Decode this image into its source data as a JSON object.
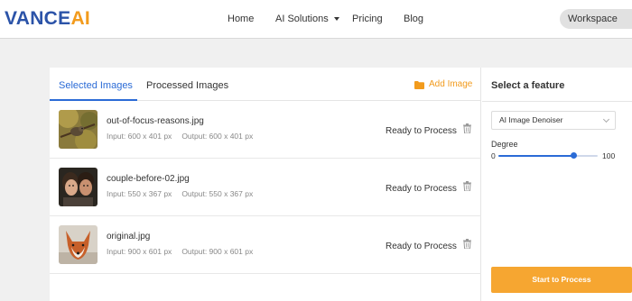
{
  "brand": {
    "part1": "VANCE",
    "part2": "AI"
  },
  "nav": {
    "home": "Home",
    "ai_solutions": "AI Solutions",
    "pricing": "Pricing",
    "blog": "Blog",
    "workspace": "Workspace"
  },
  "tabs": {
    "selected": "Selected Images",
    "processed": "Processed Images",
    "add_image": "Add Image"
  },
  "images": [
    {
      "name": "out-of-focus-reasons.jpg",
      "input": "Input: 600 x 401 px",
      "output": "Output: 600 x 401 px",
      "status": "Ready to Process"
    },
    {
      "name": "couple-before-02.jpg",
      "input": "Input: 550 x 367 px",
      "output": "Output: 550 x 367 px",
      "status": "Ready to Process"
    },
    {
      "name": "original.jpg",
      "input": "Input: 900 x 601 px",
      "output": "Output: 900 x 601 px",
      "status": "Ready to Process"
    }
  ],
  "feature": {
    "title": "Select a feature",
    "selected": "AI Image Denoiser",
    "degree_label": "Degree",
    "min": "0",
    "max": "100",
    "degree_value": 75,
    "start_button": "Start to Process"
  },
  "colors": {
    "brand_blue": "#2b53a8",
    "brand_orange": "#f29b1d",
    "accent_blue": "#2b6bd6",
    "button_orange": "#f6a631"
  },
  "icons": {
    "add_image": "folder-icon",
    "delete": "trash-icon",
    "nav_caret": "chevron-down-icon"
  }
}
